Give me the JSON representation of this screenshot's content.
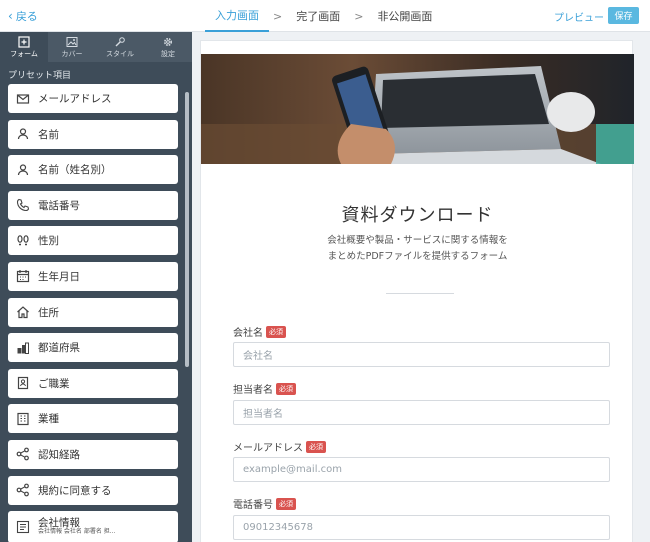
{
  "topbar": {
    "back_label": "戻る",
    "steps": [
      {
        "label": "入力画面",
        "active": true
      },
      {
        "label": "完了画面",
        "active": false
      },
      {
        "label": "非公開画面",
        "active": false
      }
    ],
    "step_separator": ">",
    "preview_label": "プレビュー",
    "save_label": "保存"
  },
  "sidebar": {
    "tabs": [
      {
        "label": "フォーム",
        "icon": "plus-square-icon",
        "active": true
      },
      {
        "label": "カバー",
        "icon": "image-icon",
        "active": false
      },
      {
        "label": "スタイル",
        "icon": "brush-icon",
        "active": false
      },
      {
        "label": "設定",
        "icon": "gear-icon",
        "active": false
      }
    ],
    "preset_label": "プリセット項目",
    "items": [
      {
        "label": "メールアドレス",
        "icon": "mail-icon"
      },
      {
        "label": "名前",
        "icon": "person-icon"
      },
      {
        "label": "名前（姓名別）",
        "icon": "person-icon"
      },
      {
        "label": "電話番号",
        "icon": "phone-icon"
      },
      {
        "label": "性別",
        "icon": "footprints-icon"
      },
      {
        "label": "生年月日",
        "icon": "calendar-icon"
      },
      {
        "label": "住所",
        "icon": "home-icon"
      },
      {
        "label": "都道府県",
        "icon": "city-icon"
      },
      {
        "label": "ご職業",
        "icon": "badge-icon"
      },
      {
        "label": "業種",
        "icon": "building-icon"
      },
      {
        "label": "認知経路",
        "icon": "share-icon"
      },
      {
        "label": "規約に同意する",
        "icon": "share-icon"
      },
      {
        "label": "会社情報",
        "sub": "会社情報 会社名 部署名 担...",
        "icon": "company-card-icon"
      }
    ]
  },
  "form": {
    "title": "資料ダウンロード",
    "description_line1": "会社概要や製品・サービスに関する情報を",
    "description_line2": "まとめたPDFファイルを提供するフォーム",
    "required_badge": "必須",
    "fields": [
      {
        "label": "会社名",
        "placeholder": "会社名"
      },
      {
        "label": "担当者名",
        "placeholder": "担当者名"
      },
      {
        "label": "メールアドレス",
        "placeholder": "example@mail.com"
      },
      {
        "label": "電話番号",
        "placeholder": "09012345678"
      }
    ]
  },
  "colors": {
    "accent": "#3aa0d8",
    "sidebar_bg": "#3e4c59",
    "required": "#d9534f"
  }
}
